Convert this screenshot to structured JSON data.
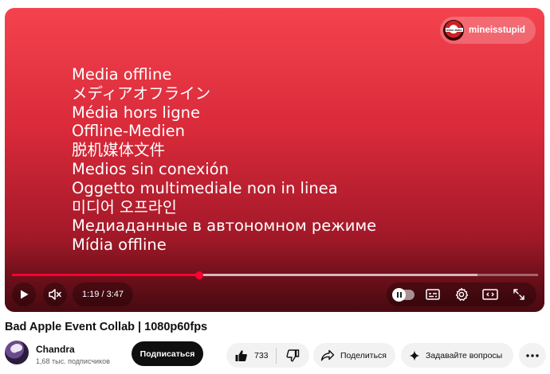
{
  "player": {
    "offline_lines": [
      "Media offline",
      "メディアオフライン",
      "Média hors ligne",
      "Offline-Medien",
      "脱机媒体文件",
      "Medios sin conexión",
      "Oggetto multimediale non in linea",
      "미디어 오프라인",
      "Медиаданные в автономном режиме",
      "Mídia offline"
    ],
    "channel_chip_name": "mineisstupid",
    "chip_avatar_text": "mine lame",
    "time_display": "1:19 / 3:47",
    "progress_fraction": 0.356,
    "loaded_fraction": 0.885
  },
  "video": {
    "title": "Bad Apple Event Collab | 1080p60fps"
  },
  "channel": {
    "name": "Chandra",
    "subscribers": "1,68 тыс. подписчиков",
    "subscribe_label": "Подписаться"
  },
  "actions": {
    "like_count": "733",
    "share_label": "Поделиться",
    "ask_label": "Задавайте вопросы"
  },
  "colors": {
    "accent": "#ff0033",
    "player_top": "#f4434e",
    "player_bottom": "#6e0f1a"
  }
}
